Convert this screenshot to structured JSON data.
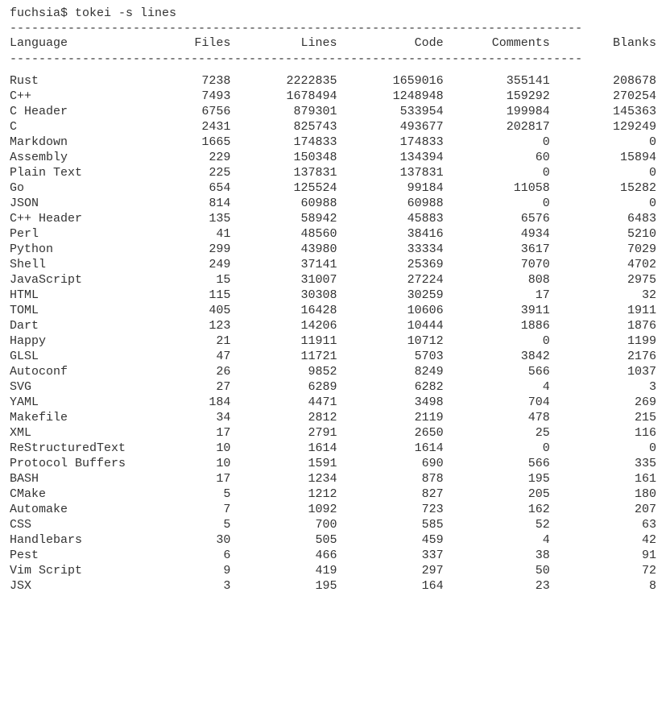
{
  "prompt": {
    "host": "fuchsia$",
    "command": "tokei -s lines"
  },
  "divider": "-------------------------------------------------------------------------------",
  "headers": {
    "language": "Language",
    "files": "Files",
    "lines": "Lines",
    "code": "Code",
    "comments": "Comments",
    "blanks": "Blanks"
  },
  "rows": [
    {
      "language": "Rust",
      "files": "7238",
      "lines": "2222835",
      "code": "1659016",
      "comments": "355141",
      "blanks": "208678"
    },
    {
      "language": "C++",
      "files": "7493",
      "lines": "1678494",
      "code": "1248948",
      "comments": "159292",
      "blanks": "270254"
    },
    {
      "language": "C Header",
      "files": "6756",
      "lines": "879301",
      "code": "533954",
      "comments": "199984",
      "blanks": "145363"
    },
    {
      "language": "C",
      "files": "2431",
      "lines": "825743",
      "code": "493677",
      "comments": "202817",
      "blanks": "129249"
    },
    {
      "language": "Markdown",
      "files": "1665",
      "lines": "174833",
      "code": "174833",
      "comments": "0",
      "blanks": "0"
    },
    {
      "language": "Assembly",
      "files": "229",
      "lines": "150348",
      "code": "134394",
      "comments": "60",
      "blanks": "15894"
    },
    {
      "language": "Plain Text",
      "files": "225",
      "lines": "137831",
      "code": "137831",
      "comments": "0",
      "blanks": "0"
    },
    {
      "language": "Go",
      "files": "654",
      "lines": "125524",
      "code": "99184",
      "comments": "11058",
      "blanks": "15282"
    },
    {
      "language": "JSON",
      "files": "814",
      "lines": "60988",
      "code": "60988",
      "comments": "0",
      "blanks": "0"
    },
    {
      "language": "C++ Header",
      "files": "135",
      "lines": "58942",
      "code": "45883",
      "comments": "6576",
      "blanks": "6483"
    },
    {
      "language": "Perl",
      "files": "41",
      "lines": "48560",
      "code": "38416",
      "comments": "4934",
      "blanks": "5210"
    },
    {
      "language": "Python",
      "files": "299",
      "lines": "43980",
      "code": "33334",
      "comments": "3617",
      "blanks": "7029"
    },
    {
      "language": "Shell",
      "files": "249",
      "lines": "37141",
      "code": "25369",
      "comments": "7070",
      "blanks": "4702"
    },
    {
      "language": "JavaScript",
      "files": "15",
      "lines": "31007",
      "code": "27224",
      "comments": "808",
      "blanks": "2975"
    },
    {
      "language": "HTML",
      "files": "115",
      "lines": "30308",
      "code": "30259",
      "comments": "17",
      "blanks": "32"
    },
    {
      "language": "TOML",
      "files": "405",
      "lines": "16428",
      "code": "10606",
      "comments": "3911",
      "blanks": "1911"
    },
    {
      "language": "Dart",
      "files": "123",
      "lines": "14206",
      "code": "10444",
      "comments": "1886",
      "blanks": "1876"
    },
    {
      "language": "Happy",
      "files": "21",
      "lines": "11911",
      "code": "10712",
      "comments": "0",
      "blanks": "1199"
    },
    {
      "language": "GLSL",
      "files": "47",
      "lines": "11721",
      "code": "5703",
      "comments": "3842",
      "blanks": "2176"
    },
    {
      "language": "Autoconf",
      "files": "26",
      "lines": "9852",
      "code": "8249",
      "comments": "566",
      "blanks": "1037"
    },
    {
      "language": "SVG",
      "files": "27",
      "lines": "6289",
      "code": "6282",
      "comments": "4",
      "blanks": "3"
    },
    {
      "language": "YAML",
      "files": "184",
      "lines": "4471",
      "code": "3498",
      "comments": "704",
      "blanks": "269"
    },
    {
      "language": "Makefile",
      "files": "34",
      "lines": "2812",
      "code": "2119",
      "comments": "478",
      "blanks": "215"
    },
    {
      "language": "XML",
      "files": "17",
      "lines": "2791",
      "code": "2650",
      "comments": "25",
      "blanks": "116"
    },
    {
      "language": "ReStructuredText",
      "files": "10",
      "lines": "1614",
      "code": "1614",
      "comments": "0",
      "blanks": "0"
    },
    {
      "language": "Protocol Buffers",
      "files": "10",
      "lines": "1591",
      "code": "690",
      "comments": "566",
      "blanks": "335"
    },
    {
      "language": "BASH",
      "files": "17",
      "lines": "1234",
      "code": "878",
      "comments": "195",
      "blanks": "161"
    },
    {
      "language": "CMake",
      "files": "5",
      "lines": "1212",
      "code": "827",
      "comments": "205",
      "blanks": "180"
    },
    {
      "language": "Automake",
      "files": "7",
      "lines": "1092",
      "code": "723",
      "comments": "162",
      "blanks": "207"
    },
    {
      "language": "CSS",
      "files": "5",
      "lines": "700",
      "code": "585",
      "comments": "52",
      "blanks": "63"
    },
    {
      "language": "Handlebars",
      "files": "30",
      "lines": "505",
      "code": "459",
      "comments": "4",
      "blanks": "42"
    },
    {
      "language": "Pest",
      "files": "6",
      "lines": "466",
      "code": "337",
      "comments": "38",
      "blanks": "91"
    },
    {
      "language": "Vim Script",
      "files": "9",
      "lines": "419",
      "code": "297",
      "comments": "50",
      "blanks": "72"
    },
    {
      "language": "JSX",
      "files": "3",
      "lines": "195",
      "code": "164",
      "comments": "23",
      "blanks": "8"
    }
  ]
}
